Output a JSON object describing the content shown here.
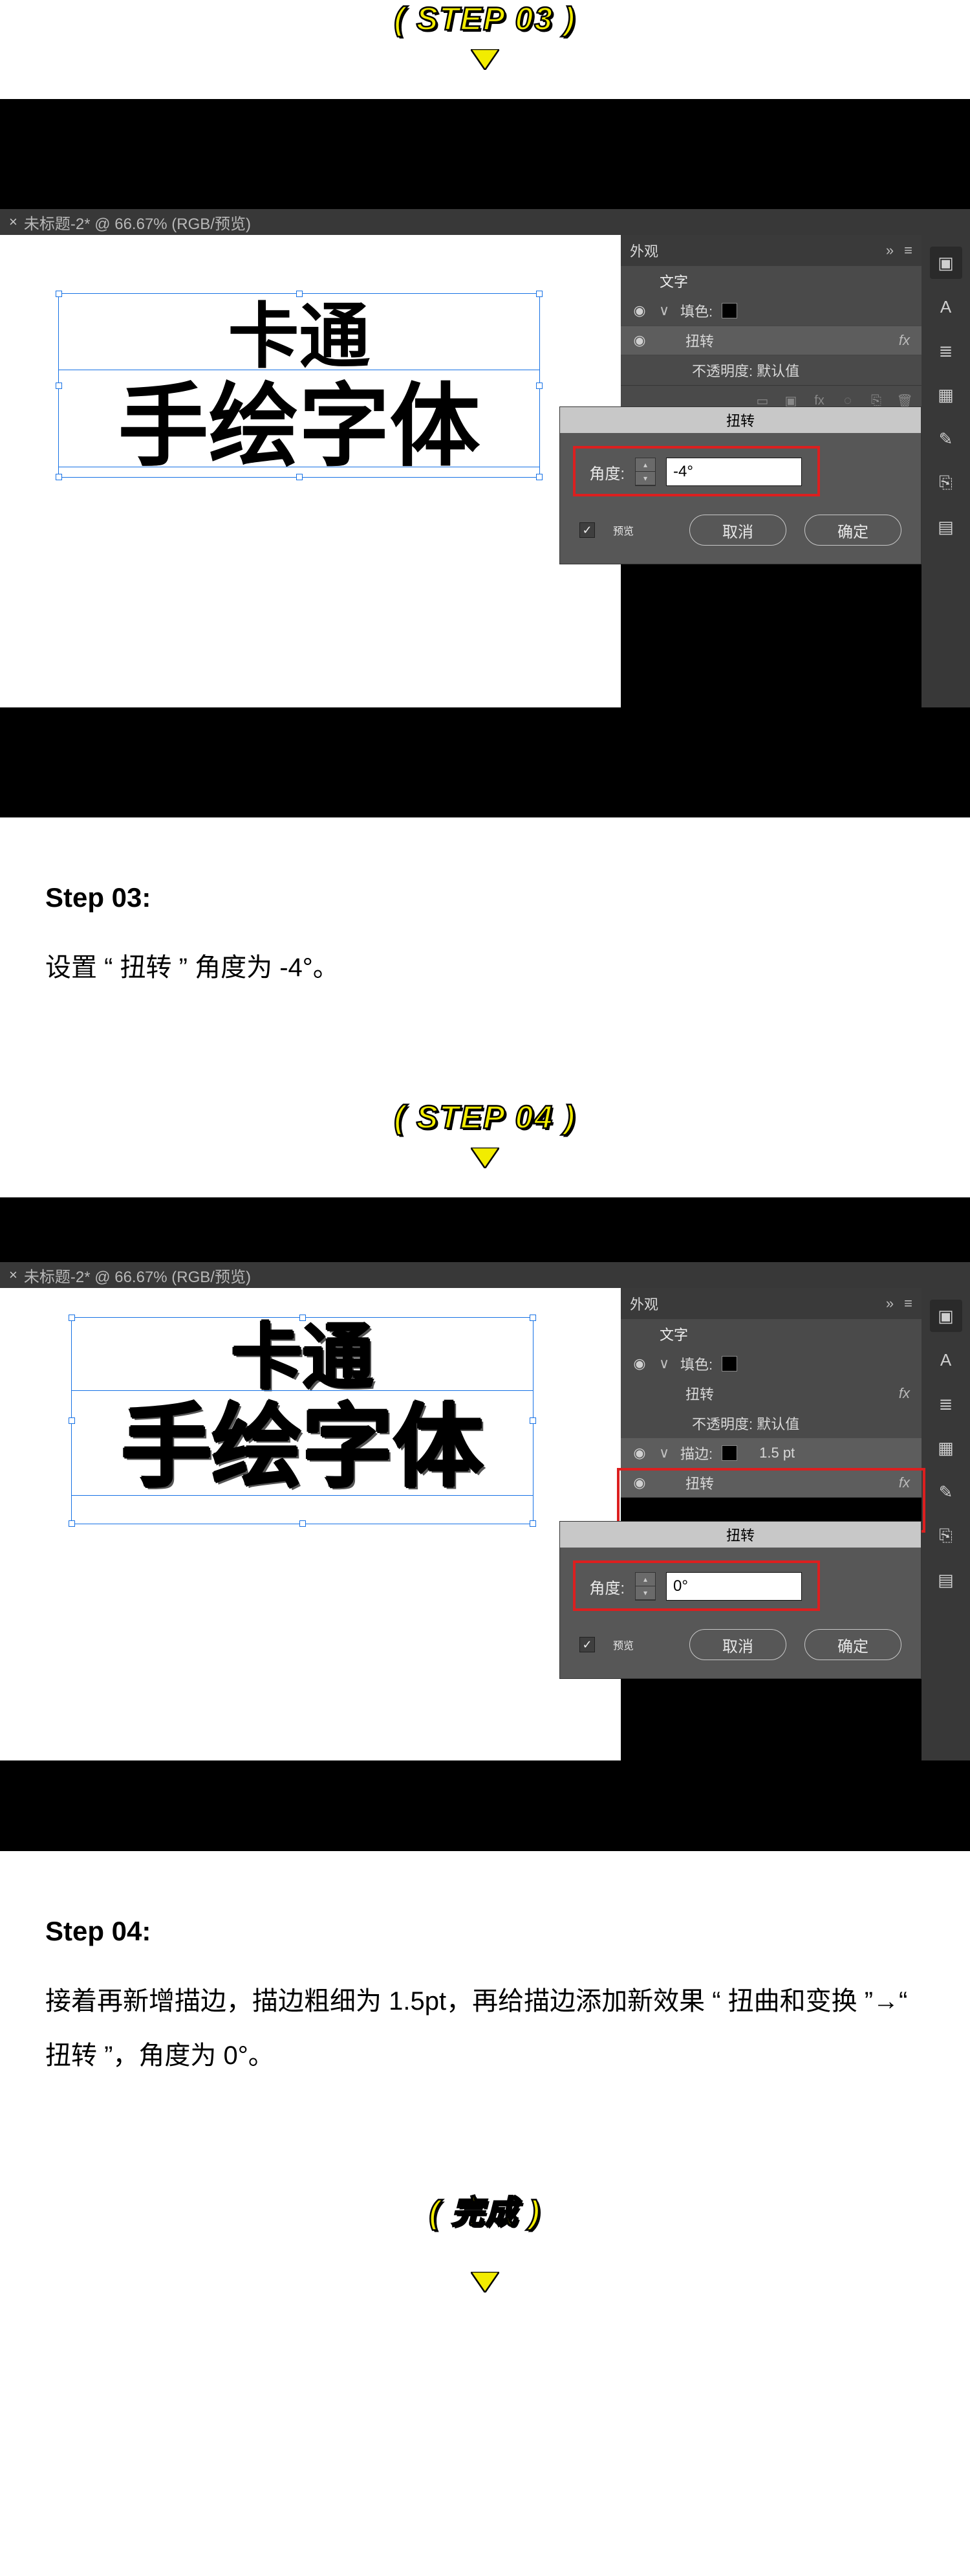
{
  "pill": {
    "step03": "( STEP 03 )",
    "step04": "( STEP 04 )",
    "done": "( 完成 )"
  },
  "tab": {
    "title": "未标题-2* @ 66.67% (RGB/预览)",
    "close": "×"
  },
  "art": {
    "line1": "卡通",
    "line2": "手绘字体"
  },
  "appearance": {
    "panel_title": "外观",
    "menu_glyph": "≡",
    "text_row": "文字",
    "fill_label": "填色:",
    "twist_label": "扭转",
    "opacity_label": "不透明度: 默认值",
    "stroke_label": "描边:",
    "stroke_value": "1.5 pt",
    "fx_glyph": "fx",
    "chevron_right": "›",
    "chevron_down": "∨",
    "eye": "◉"
  },
  "toolstrip": {
    "props": "▣",
    "typeA": "A",
    "layers": "≣",
    "swatch": "▦",
    "brush": "✎",
    "link": "⎘",
    "actions": "▤"
  },
  "dialog": {
    "title": "扭转",
    "angle_label": "角度:",
    "angle_step03": "-4°",
    "angle_step04": "0°",
    "preview": "预览",
    "cancel": "取消",
    "ok": "确定",
    "check": "✓",
    "up": "▴",
    "down": "▾"
  },
  "explain": {
    "s03_label": "Step 03:",
    "s03_text": "设置 “ 扭转 ” 角度为 -4°。",
    "s04_label": "Step 04:",
    "s04_text": "接着再新增描边，描边粗细为 1.5pt，再给描边添加新效果 “ 扭曲和变换 ”→“ 扭转 ”，角度为 0°。"
  }
}
